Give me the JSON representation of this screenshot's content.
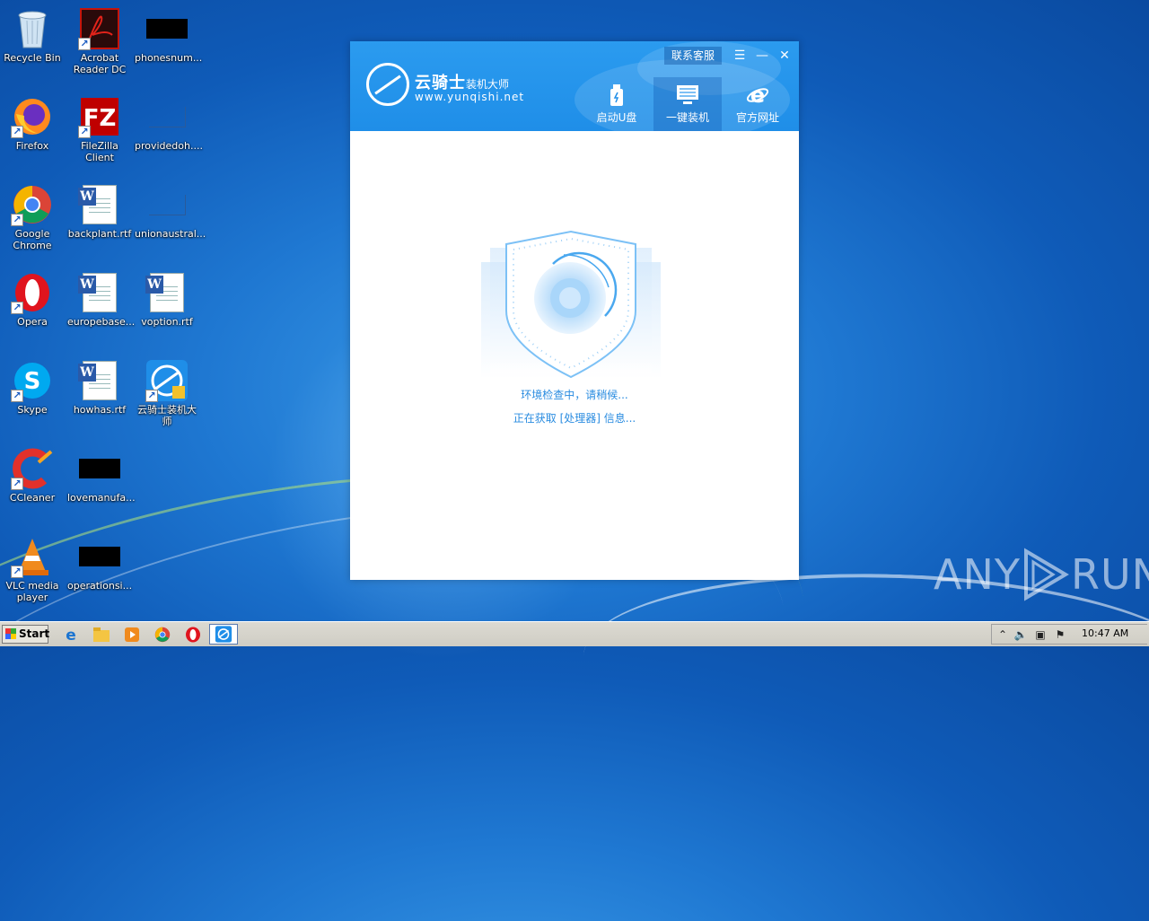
{
  "desktop": {
    "icons": [
      {
        "label": "Recycle Bin"
      },
      {
        "label": "Acrobat Reader DC"
      },
      {
        "label": "phonesnum..."
      },
      {
        "label": "Firefox"
      },
      {
        "label": "FileZilla Client"
      },
      {
        "label": "providedoh...."
      },
      {
        "label": "Google Chrome"
      },
      {
        "label": "backplant.rtf"
      },
      {
        "label": "unionaustral..."
      },
      {
        "label": "Opera"
      },
      {
        "label": "europebase..."
      },
      {
        "label": "voption.rtf"
      },
      {
        "label": "Skype"
      },
      {
        "label": "howhas.rtf"
      },
      {
        "label": "云骑士装机大师"
      },
      {
        "label": "CCleaner"
      },
      {
        "label": "lovemanufa..."
      },
      {
        "label": "VLC media player"
      },
      {
        "label": "operationsi..."
      }
    ]
  },
  "app": {
    "brand_cn": "云骑士",
    "brand_sub": "装机大师",
    "brand_url": "www.yunqishi.net",
    "support_label": "联系客服",
    "controls": {
      "menu": "☰",
      "minimize": "—",
      "close": "✕"
    },
    "tabs": [
      {
        "label": "启动U盘",
        "active": false
      },
      {
        "label": "一键装机",
        "active": true
      },
      {
        "label": "官方网址",
        "active": false
      }
    ],
    "status_line1": "环境检查中，请稍候...",
    "status_line2": "正在获取 [处理器] 信息..."
  },
  "watermark": {
    "text_left": "ANY",
    "text_right": "RUN"
  },
  "taskbar": {
    "start_label": "Start",
    "clock": "10:47 AM"
  },
  "colors": {
    "accent": "#1f8ee8",
    "status_text": "#2a8ce0"
  }
}
